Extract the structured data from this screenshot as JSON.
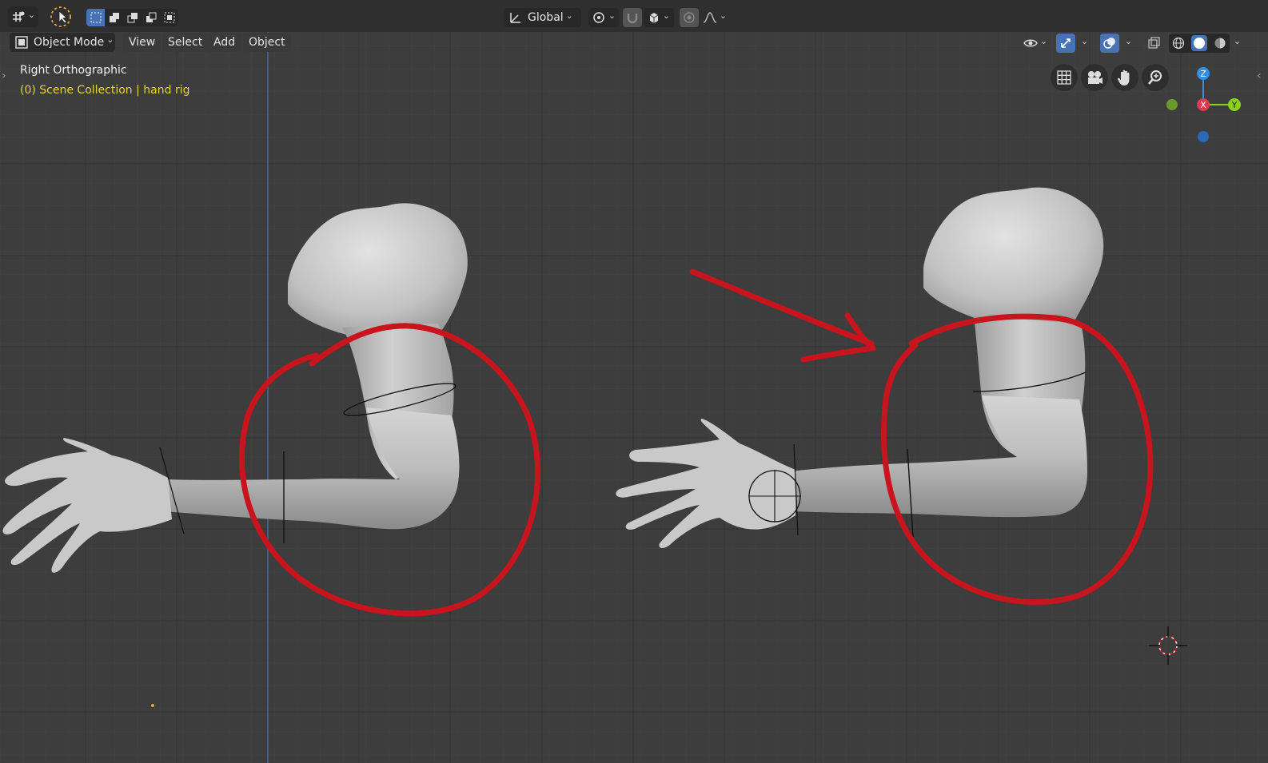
{
  "header": {
    "editor_type_icon": "viewport-icon",
    "transform_orientation": "Global",
    "select_modes": [
      "select-box-icon",
      "select-new-icon",
      "select-extend-icon",
      "select-subtract-icon",
      "select-intersect-icon"
    ]
  },
  "menubar": {
    "mode": "Object Mode",
    "menus": [
      "View",
      "Select",
      "Add",
      "Object"
    ]
  },
  "viewport": {
    "view_name": "Right Orthographic",
    "collection_info": "(0) Scene Collection | hand rig"
  },
  "gizmo": {
    "z_label": "Z",
    "x_label": "X",
    "y_label": "Y"
  },
  "colors": {
    "accent": "#4772b3",
    "annotation": "#c8141c",
    "collection_text": "#e5d23b",
    "grid_bg": "#3d3d3d"
  }
}
